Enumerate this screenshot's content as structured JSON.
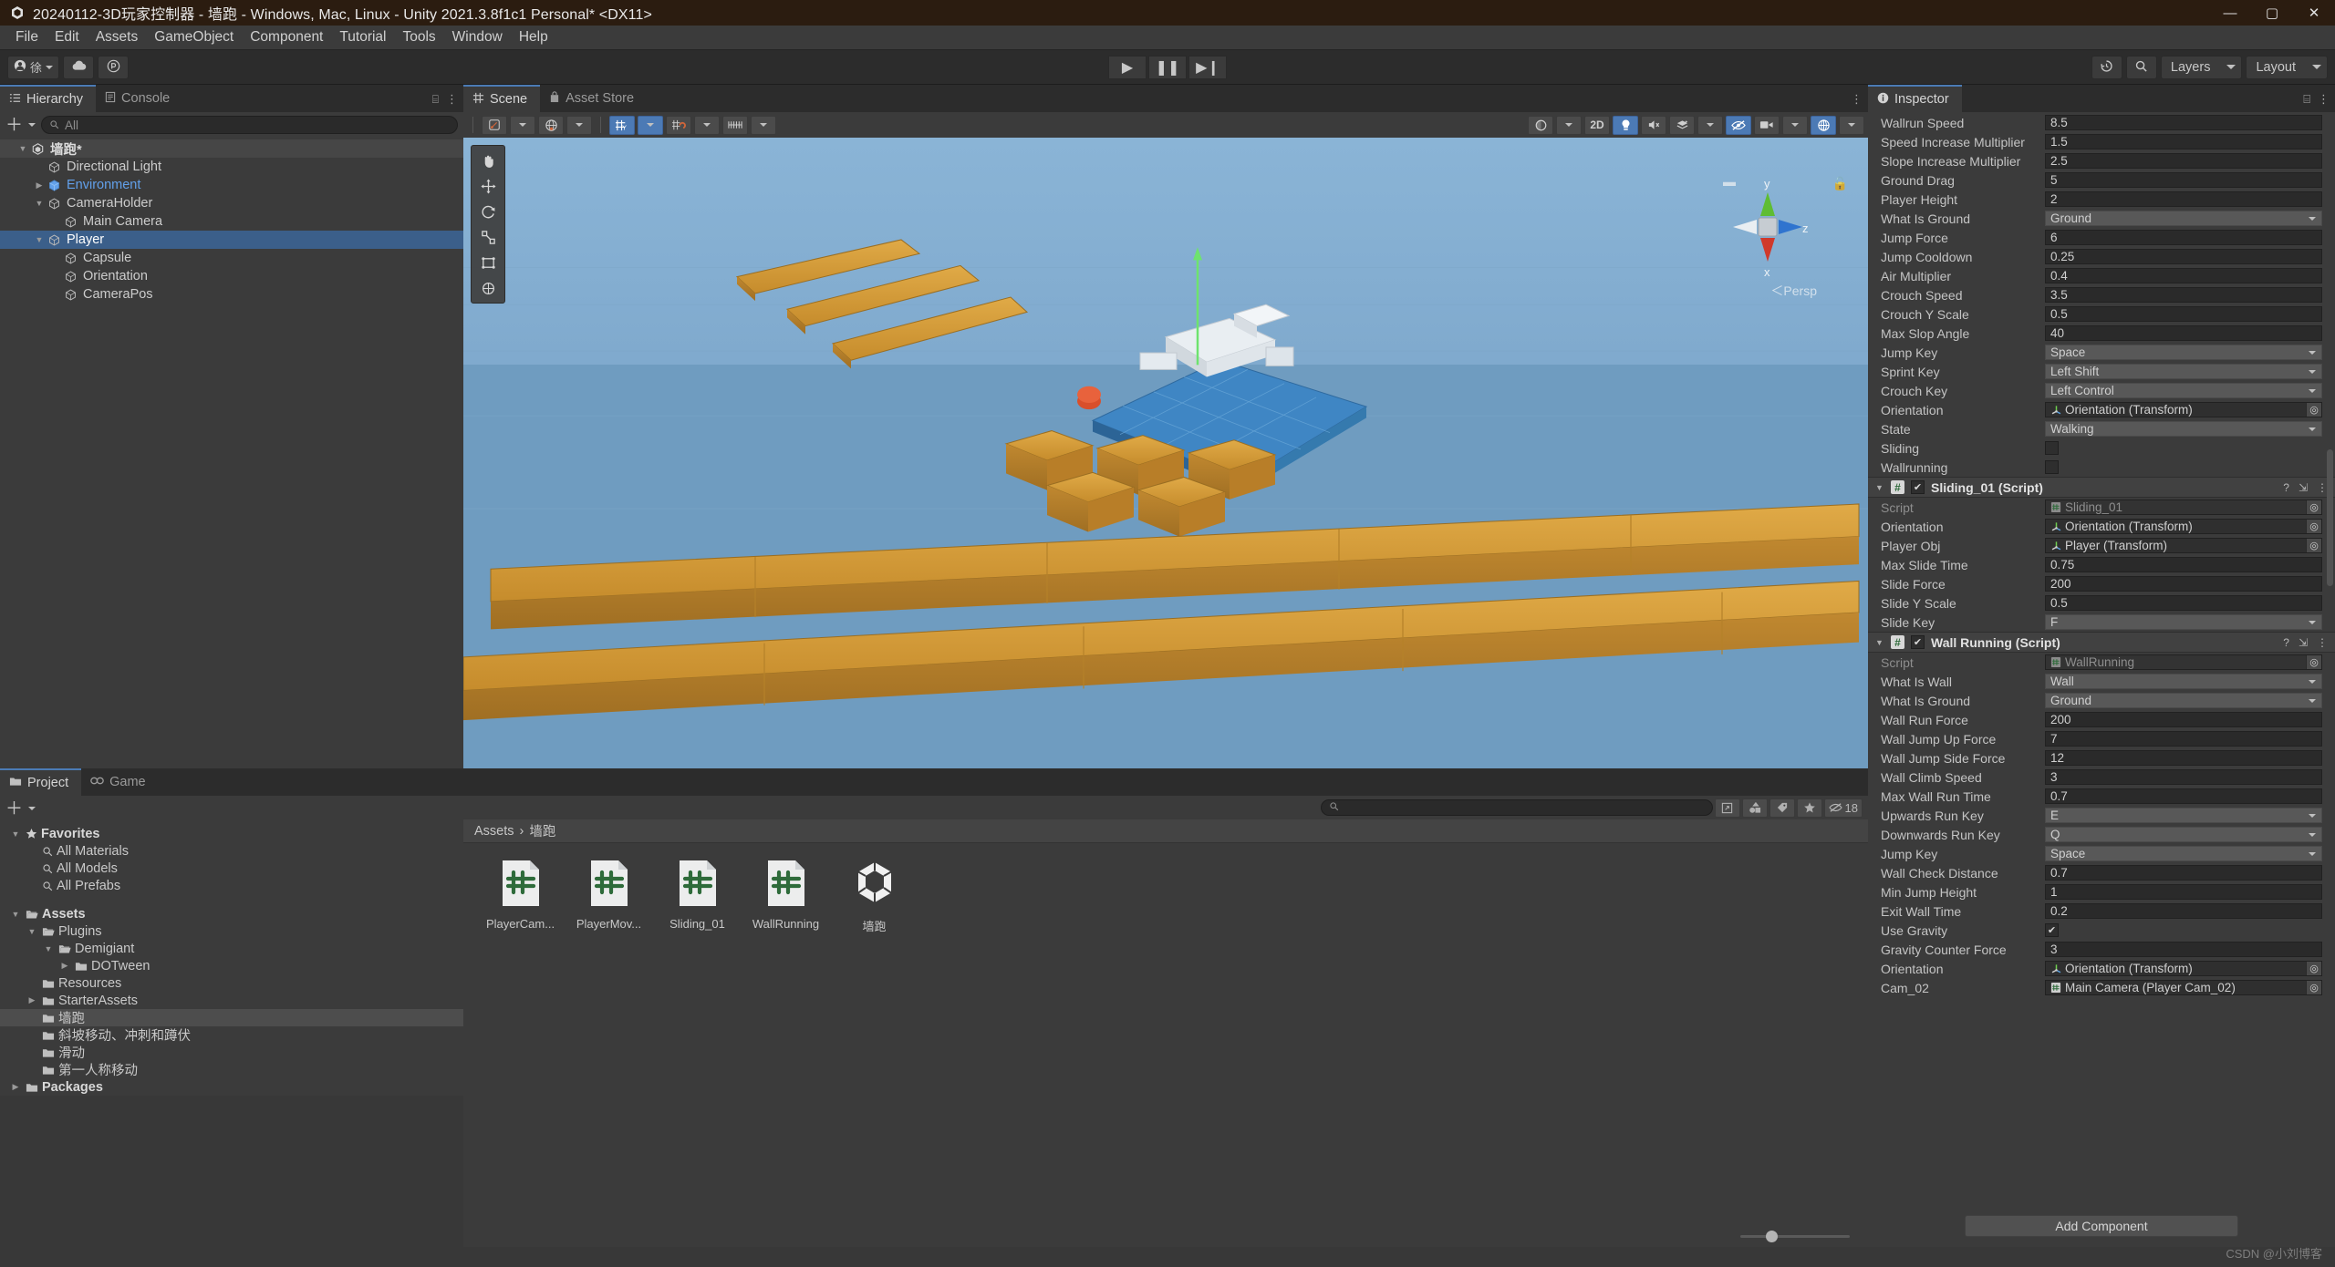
{
  "window": {
    "title": "20240112-3D玩家控制器 - 墙跑 - Windows, Mac, Linux - Unity 2021.3.8f1c1 Personal* <DX11>",
    "minimize": "—",
    "maximize": "▢",
    "close": "✕"
  },
  "menubar": {
    "items": [
      "File",
      "Edit",
      "Assets",
      "GameObject",
      "Component",
      "Tutorial",
      "Tools",
      "Window",
      "Help"
    ]
  },
  "toolbar": {
    "account_label": "徐",
    "play": "▶",
    "pause": "❚❚",
    "step": "▶❙",
    "history_icon": "history-icon",
    "search_icon": "search-icon",
    "layers": "Layers",
    "layout": "Layout"
  },
  "hierarchy": {
    "tabs": [
      {
        "label": "Hierarchy",
        "icon": "hierarchy-icon",
        "active": true
      },
      {
        "label": "Console",
        "icon": "console-icon",
        "active": false
      }
    ],
    "search_placeholder": "All",
    "items": [
      {
        "label": "墙跑*",
        "indent": 0,
        "kind": "scene",
        "expanded": true,
        "selected": false
      },
      {
        "label": "Directional Light",
        "indent": 1,
        "kind": "object",
        "expanded": null,
        "selected": false
      },
      {
        "label": "Environment",
        "indent": 1,
        "kind": "prefab",
        "expanded": false,
        "selected": false
      },
      {
        "label": "CameraHolder",
        "indent": 1,
        "kind": "object",
        "expanded": true,
        "selected": false
      },
      {
        "label": "Main Camera",
        "indent": 2,
        "kind": "object",
        "expanded": null,
        "selected": false
      },
      {
        "label": "Player",
        "indent": 1,
        "kind": "object",
        "expanded": true,
        "selected": true
      },
      {
        "label": "Capsule",
        "indent": 2,
        "kind": "object",
        "expanded": null,
        "selected": false
      },
      {
        "label": "Orientation",
        "indent": 2,
        "kind": "object",
        "expanded": null,
        "selected": false
      },
      {
        "label": "CameraPos",
        "indent": 2,
        "kind": "object",
        "expanded": null,
        "selected": false
      }
    ]
  },
  "scene": {
    "tabs": [
      {
        "label": "Scene",
        "icon": "scene-grid-icon",
        "active": true
      },
      {
        "label": "Asset Store",
        "icon": "store-icon",
        "active": false
      }
    ],
    "toolbar": {
      "shading_mode": "shaded-icon",
      "draw_space": "global-icon",
      "grid_snap": "grid-snap-icon",
      "magnet_snap": "magnet-icon",
      "ruler": "ruler-icon",
      "gizmo_sphere": "sphere-icon",
      "mode_2d": "2D",
      "lighting": "light-bulb-icon",
      "audio": "audio-mute-icon",
      "fx": "effects-icon",
      "hidden": "visibility-off-icon",
      "camera": "camera-icon",
      "gizmos": "gizmos-icon"
    },
    "transform_tools": [
      {
        "name": "hand-tool",
        "glyph": "✋",
        "active": false
      },
      {
        "name": "move-tool",
        "glyph": "✜",
        "active": false
      },
      {
        "name": "rotate-tool",
        "glyph": "⟳",
        "active": false
      },
      {
        "name": "scale-tool",
        "glyph": "⤢",
        "active": false
      },
      {
        "name": "rect-tool",
        "glyph": "▣",
        "active": false
      },
      {
        "name": "transform-tool",
        "glyph": "✧",
        "active": false
      }
    ],
    "axis_gizmo": {
      "x": "x",
      "y": "y",
      "z": "z",
      "mode": "Persp"
    }
  },
  "project": {
    "tabs": [
      {
        "label": "Project",
        "icon": "folder-icon",
        "active": true
      },
      {
        "label": "Game",
        "icon": "gamepad-icon",
        "active": false
      }
    ],
    "search_placeholder": "",
    "tree": [
      {
        "label": "Favorites",
        "indent": 0,
        "icon": "star-icon",
        "expanded": true,
        "bold": true,
        "selected": false
      },
      {
        "label": "All Materials",
        "indent": 1,
        "icon": "search-icon",
        "expanded": null,
        "bold": false,
        "selected": false
      },
      {
        "label": "All Models",
        "indent": 1,
        "icon": "search-icon",
        "expanded": null,
        "bold": false,
        "selected": false
      },
      {
        "label": "All Prefabs",
        "indent": 1,
        "icon": "search-icon",
        "expanded": null,
        "bold": false,
        "selected": false
      },
      {
        "label": "",
        "indent": 0,
        "icon": "spacer",
        "expanded": null,
        "bold": false,
        "selected": false
      },
      {
        "label": "Assets",
        "indent": 0,
        "icon": "folder-open-icon",
        "expanded": true,
        "bold": true,
        "selected": false
      },
      {
        "label": "Plugins",
        "indent": 1,
        "icon": "folder-open-icon",
        "expanded": true,
        "bold": false,
        "selected": false
      },
      {
        "label": "Demigiant",
        "indent": 2,
        "icon": "folder-open-icon",
        "expanded": true,
        "bold": false,
        "selected": false
      },
      {
        "label": "DOTween",
        "indent": 3,
        "icon": "folder-icon",
        "expanded": false,
        "bold": false,
        "selected": false
      },
      {
        "label": "Resources",
        "indent": 1,
        "icon": "folder-icon",
        "expanded": null,
        "bold": false,
        "selected": false
      },
      {
        "label": "StarterAssets",
        "indent": 1,
        "icon": "folder-icon",
        "expanded": false,
        "bold": false,
        "selected": false
      },
      {
        "label": "墙跑",
        "indent": 1,
        "icon": "folder-icon",
        "expanded": null,
        "bold": false,
        "selected": true
      },
      {
        "label": "斜坡移动、冲刺和蹲伏",
        "indent": 1,
        "icon": "folder-icon",
        "expanded": null,
        "bold": false,
        "selected": false
      },
      {
        "label": "滑动",
        "indent": 1,
        "icon": "folder-icon",
        "expanded": null,
        "bold": false,
        "selected": false
      },
      {
        "label": "第一人称移动",
        "indent": 1,
        "icon": "folder-icon",
        "expanded": null,
        "bold": false,
        "selected": false
      },
      {
        "label": "Packages",
        "indent": 0,
        "icon": "folder-icon",
        "expanded": false,
        "bold": true,
        "selected": false
      }
    ],
    "breadcrumb": [
      "Assets",
      "墙跑"
    ],
    "assets": [
      {
        "label": "PlayerCam...",
        "type": "csharp"
      },
      {
        "label": "PlayerMov...",
        "type": "csharp"
      },
      {
        "label": "Sliding_01",
        "type": "csharp"
      },
      {
        "label": "WallRunning",
        "type": "csharp"
      },
      {
        "label": "墙跑",
        "type": "unity-scene"
      }
    ],
    "hidden_count": "18",
    "toolbar_icons": [
      "shapes-icon",
      "tag-icon",
      "star-icon",
      "visibility-off-icon"
    ]
  },
  "inspector": {
    "tab": {
      "label": "Inspector",
      "icon": "info-icon"
    },
    "lock_icon": "lock-open-icon",
    "menu_icon": "kebab-menu-icon",
    "player_movement_rows": [
      {
        "label": "Wallrun Speed",
        "value": "8.5",
        "kind": "number"
      },
      {
        "label": "Speed Increase Multiplier",
        "value": "1.5",
        "kind": "number"
      },
      {
        "label": "Slope Increase Multiplier",
        "value": "2.5",
        "kind": "number"
      },
      {
        "label": "Ground Drag",
        "value": "5",
        "kind": "number"
      },
      {
        "label": "Player Height",
        "value": "2",
        "kind": "number"
      },
      {
        "label": "What Is Ground",
        "value": "Ground",
        "kind": "popup"
      },
      {
        "label": "Jump Force",
        "value": "6",
        "kind": "number"
      },
      {
        "label": "Jump Cooldown",
        "value": "0.25",
        "kind": "number"
      },
      {
        "label": "Air Multiplier",
        "value": "0.4",
        "kind": "number"
      },
      {
        "label": "Crouch Speed",
        "value": "3.5",
        "kind": "number"
      },
      {
        "label": "Crouch Y Scale",
        "value": "0.5",
        "kind": "number"
      },
      {
        "label": "Max Slop Angle",
        "value": "40",
        "kind": "number"
      },
      {
        "label": "Jump Key",
        "value": "Space",
        "kind": "popup"
      },
      {
        "label": "Sprint Key",
        "value": "Left Shift",
        "kind": "popup"
      },
      {
        "label": "Crouch Key",
        "value": "Left Control",
        "kind": "popup"
      },
      {
        "label": "Orientation",
        "value": "Orientation (Transform)",
        "kind": "objref-transform"
      },
      {
        "label": "State",
        "value": "Walking",
        "kind": "popup"
      },
      {
        "label": "Sliding",
        "value": "",
        "kind": "checkbox-off"
      },
      {
        "label": "Wallrunning",
        "value": "",
        "kind": "checkbox-off"
      }
    ],
    "components": [
      {
        "title": "Sliding_01 (Script)",
        "enabled": true,
        "rows": [
          {
            "label": "Script",
            "value": "Sliding_01",
            "kind": "objref-script-disabled"
          },
          {
            "label": "Orientation",
            "value": "Orientation (Transform)",
            "kind": "objref-transform"
          },
          {
            "label": "Player Obj",
            "value": "Player (Transform)",
            "kind": "objref-transform"
          },
          {
            "label": "Max Slide Time",
            "value": "0.75",
            "kind": "number"
          },
          {
            "label": "Slide Force",
            "value": "200",
            "kind": "number"
          },
          {
            "label": "Slide Y Scale",
            "value": "0.5",
            "kind": "number"
          },
          {
            "label": "Slide Key",
            "value": "F",
            "kind": "popup"
          }
        ]
      },
      {
        "title": "Wall Running (Script)",
        "enabled": true,
        "rows": [
          {
            "label": "Script",
            "value": "WallRunning",
            "kind": "objref-script-disabled"
          },
          {
            "label": "What Is Wall",
            "value": "Wall",
            "kind": "popup"
          },
          {
            "label": "What Is Ground",
            "value": "Ground",
            "kind": "popup"
          },
          {
            "label": "Wall Run Force",
            "value": "200",
            "kind": "number"
          },
          {
            "label": "Wall Jump Up Force",
            "value": "7",
            "kind": "number"
          },
          {
            "label": "Wall Jump Side Force",
            "value": "12",
            "kind": "number"
          },
          {
            "label": "Wall Climb Speed",
            "value": "3",
            "kind": "number"
          },
          {
            "label": "Max Wall Run Time",
            "value": "0.7",
            "kind": "number"
          },
          {
            "label": "Upwards Run Key",
            "value": "E",
            "kind": "popup"
          },
          {
            "label": "Downwards Run Key",
            "value": "Q",
            "kind": "popup"
          },
          {
            "label": "Jump Key",
            "value": "Space",
            "kind": "popup"
          },
          {
            "label": "Wall Check Distance",
            "value": "0.7",
            "kind": "number"
          },
          {
            "label": "Min Jump Height",
            "value": "1",
            "kind": "number"
          },
          {
            "label": "Exit Wall Time",
            "value": "0.2",
            "kind": "number"
          },
          {
            "label": "Use Gravity",
            "value": "",
            "kind": "checkbox-on"
          },
          {
            "label": "Gravity Counter Force",
            "value": "3",
            "kind": "number"
          },
          {
            "label": "Orientation",
            "value": "Orientation (Transform)",
            "kind": "objref-transform"
          },
          {
            "label": "Cam_02",
            "value": "Main Camera (Player Cam_02)",
            "kind": "objref-camera"
          }
        ]
      }
    ],
    "add_component": "Add Component"
  },
  "footer": {
    "watermark": "CSDN @小刘博客"
  },
  "colors": {
    "accent_blue": "#4c7ab5",
    "selection_blue": "#3b5f8a",
    "panel_bg": "#3b3b3b",
    "toolbar_bg": "#2c2c2c",
    "titlebar_bg": "#2b1c10",
    "text": "#c9c9c9",
    "csharp_green": "#2e6b3a",
    "plank_orange": "#d39a36"
  }
}
